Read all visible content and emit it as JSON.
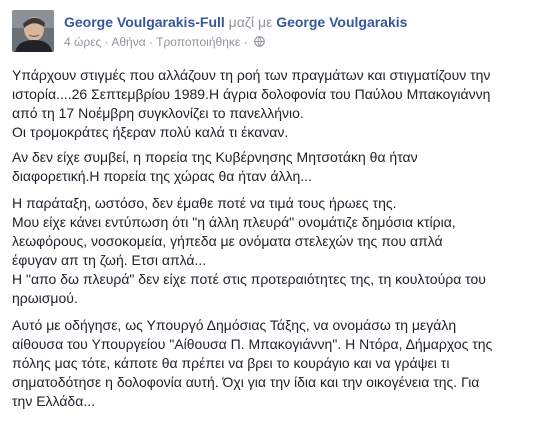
{
  "post": {
    "author": "George Voulgarakis-Full",
    "with_text": "μαζί με",
    "coauthor": "George Voulgarakis",
    "time": "4 ώρες",
    "separator": "·",
    "location": "Αθήνα",
    "edited": "Τροποποιήθηκε",
    "privacy_icon": "globe-icon",
    "paragraphs": [
      [
        "Υπάρχουν στιγμές που αλλάζουν τη ροή των πραγμάτων και στιγματίζουν την",
        "ιστορία....26 Σεπτεμβρίου 1989.Η άγρια δολοφονία του Παύλου Μπακογιάννη",
        "από τη 17 Νοέμβρη συγκλονίζει το πανελλήνιο.",
        "Οι τρομοκράτες ήξεραν πολύ καλά τι έκαναν."
      ],
      [
        "Αν δεν είχε συμβεί, η πορεία της Κυβέρνησης Μητσοτάκη θα ήταν",
        "διαφορετική.Η πορεία της χώρας θα ήταν άλλη..."
      ],
      [
        "Η παράταξη, ωστόσο, δεν έμαθε ποτέ να τιμά τους ήρωες της.",
        "Μου είχε κάνει εντύπωση ότι \"η άλλη πλευρά\" ονομάτιζε δημόσια κτίρια,",
        "λεωφόρους, νοσοκομεία, γήπεδα με ονόματα στελεχών της που απλά",
        "έφυγαν απ τη ζωή. Ετσι απλά...",
        "Η \"απο δω πλευρά\" δεν είχε ποτέ στις προτεραιότητες της, τη κουλτούρα του",
        "ηρωισμού."
      ],
      [
        "Αυτό με οδήγησε, ως Υπουργό Δημόσιας Τάξης, να ονομάσω τη μεγάλη",
        "αίθουσα του Υπουργείου \"Αίθουσα Π. Μπακογιάννη\". Η Ντόρα, Δήμαρχος της",
        "πόλης μας τότε, κάποτε θα πρέπει να βρει το κουράγιο και να γράψει τι",
        "σηματοδότησε η δολοφονία αυτή. Όχι για την ίδια και την οικογένεια της. Για",
        "την Ελλάδα..."
      ]
    ]
  }
}
